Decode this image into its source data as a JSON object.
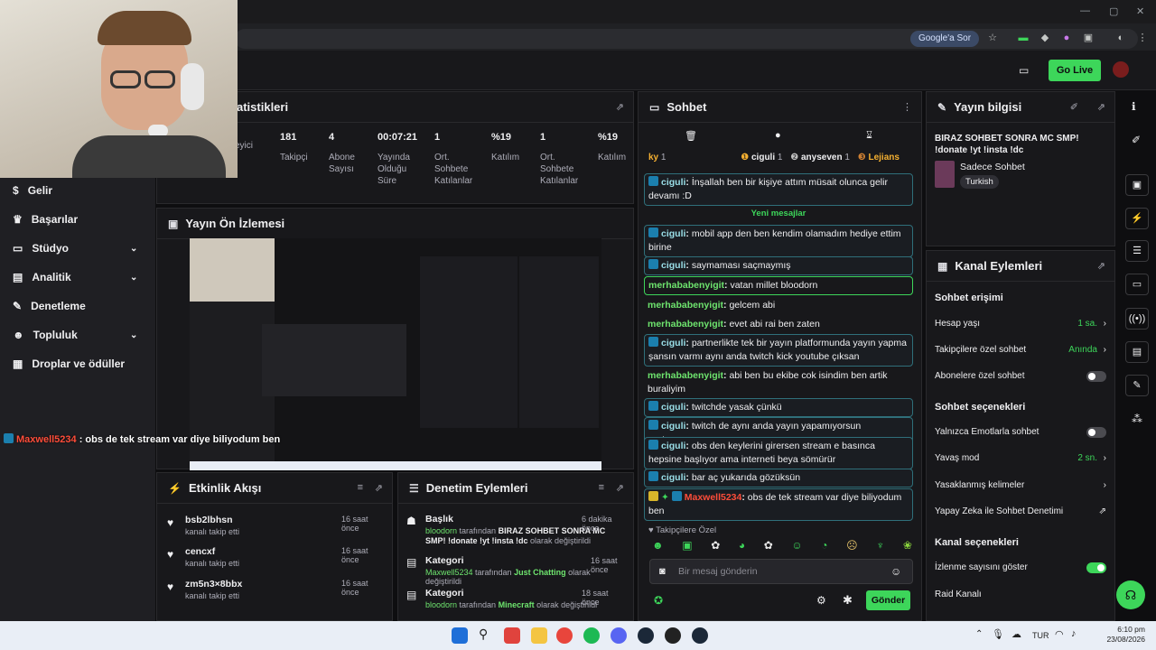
{
  "browser": {
    "google_sor": "Google'a Sor"
  },
  "topnav": {
    "go_live": "Go Live"
  },
  "stats": {
    "title": "atistikleri",
    "items": [
      {
        "value": "",
        "label": "eyici"
      },
      {
        "value": "181",
        "label": "Takipçi"
      },
      {
        "value": "4",
        "label": "Abone\nSayısı"
      },
      {
        "value": "00:07:21",
        "label": "Yayında\nOlduğu\nSüre"
      },
      {
        "value": "1",
        "label": "Ort.\nSohbete\nKatılanlar"
      },
      {
        "value": "%19",
        "label": "Katılım"
      },
      {
        "value": "1",
        "label": "Ort.\nSohbete\nKatılanlar"
      },
      {
        "value": "%19",
        "label": "Katılım"
      }
    ]
  },
  "sidebar": {
    "items": [
      {
        "label": "Gelir",
        "icon": "dollar-icon"
      },
      {
        "label": "Başarılar",
        "icon": "trophy-icon"
      },
      {
        "label": "Stüdyo",
        "icon": "studio-icon"
      },
      {
        "label": "Analitik",
        "icon": "analytics-icon"
      },
      {
        "label": "Denetleme",
        "icon": "wrench-icon"
      },
      {
        "label": "Topluluk",
        "icon": "people-icon"
      },
      {
        "label": "Droplar ve ödüller",
        "icon": "gift-icon"
      }
    ]
  },
  "preview": {
    "title": "Yayın Ön İzlemesi"
  },
  "overlay": {
    "user": "Maxwell5234",
    "text": " : obs de tek stream var diye biliyodum ben"
  },
  "chat": {
    "title": "Sohbet",
    "leaderboard": [
      {
        "name": "ky",
        "count": "1"
      },
      {
        "name": "ciguli",
        "count": "1"
      },
      {
        "name": "anyseven",
        "count": "1"
      },
      {
        "name": "Lejians",
        "count": ""
      }
    ],
    "new_messages": "Yeni mesajlar",
    "messages": [
      {
        "user": "ciguli",
        "text": " İnşallah ben bir kişiye attım müsait olunca gelir devamı :D"
      },
      {
        "user": "ciguli",
        "text": " mobil app den ben kendim olamadım hediye ettim birine"
      },
      {
        "user": "ciguli",
        "text": " saymaması saçmaymış"
      },
      {
        "user": "merhababenyigit",
        "text": " vatan millet bloodorn"
      },
      {
        "user": "merhababenyigit",
        "text": " gelcem abi"
      },
      {
        "user": "merhababenyigit",
        "text": " evet abi rai ben zaten"
      },
      {
        "user": "ciguli",
        "text": " partnerlikte tek bir yayın platformunda yayın yapma şansın varmı aynı anda twitch kick youtube çıksan"
      },
      {
        "user": "merhababenyigit",
        "text": " abi ben bu ekibe cok isindim ben artik buraliyim"
      },
      {
        "user": "ciguli",
        "text": " twitchde yasak çünkü"
      },
      {
        "user": "ciguli",
        "text": " twitch de aynı anda yayın yapamıyorsun partnersen"
      },
      {
        "user": "ciguli",
        "text": " obs den keylerini girersen stream e basınca hepsine başlıyor ama interneti beya sömürür"
      },
      {
        "user": "ciguli",
        "text": " bar aç yukarıda gözüksün"
      },
      {
        "user": "Maxwell5234",
        "text": " obs de tek stream var diye biliyodum ben"
      }
    ],
    "followers_only": "Takipçilere Özel",
    "input_placeholder": "Bir mesaj gönderin",
    "send_label": "Gönder"
  },
  "stream_info": {
    "title": "Yayın bilgisi",
    "stream_title": "BIRAZ SOHBET SONRA MC SMP! !donate !yt !insta !dc",
    "category": "Sadece Sohbet",
    "language": "Turkish"
  },
  "channel_actions": {
    "title": "Kanal Eylemleri",
    "chat_access_heading": "Sohbet erişimi",
    "account_age_label": "Hesap yaşı",
    "account_age_value": "1 sa.",
    "followers_chat_label": "Takipçilere özel sohbet",
    "followers_chat_value": "Anında",
    "subscribers_chat_label": "Abonelere özel sohbet",
    "chat_options_heading": "Sohbet seçenekleri",
    "emote_only_label": "Yalnızca Emotlarla sohbet",
    "slow_mode_label": "Yavaş mod",
    "slow_mode_value": "2 sn.",
    "banned_words_label": "Yasaklanmış kelimeler",
    "ai_moderation_label": "Yapay Zeka ile Sohbet Denetimi",
    "channel_options_heading": "Kanal seçenekleri",
    "show_viewcount_label": "İzlenme sayısını göster",
    "raid_label": "Raid Kanalı"
  },
  "activity_feed": {
    "title": "Etkinlik Akışı",
    "items": [
      {
        "name": "bsb2lbhsn",
        "sub": "kanalı takip etti",
        "time": "16 saat önce"
      },
      {
        "name": "cencxf",
        "sub": "kanalı takip etti",
        "time": "16 saat önce"
      },
      {
        "name": "zm5n3×8bbx",
        "sub": "kanalı takip etti",
        "time": "16 saat önce"
      }
    ]
  },
  "mod_actions": {
    "title": "Denetim Eylemleri",
    "items": [
      {
        "kind": "Başlık",
        "time": "6 dakika önce",
        "actor": "bloodorn",
        "mid": " tarafından ",
        "target": "BIRAZ SOHBET SONRA MC SMP! !donate !yt !insta !dc",
        "end": " olarak değiştirildi"
      },
      {
        "kind": "Kategori",
        "time": "16 saat önce",
        "actor": "Maxwell5234",
        "mid": " tarafından ",
        "target": "Just Chatting",
        "end": " olarak değiştirildi"
      },
      {
        "kind": "Kategori",
        "time": "18 saat önce",
        "actor": "bloodorn",
        "mid": " tarafından ",
        "target": "Minecraft",
        "end": " olarak değiştirildi"
      }
    ]
  },
  "taskbar": {
    "lang": "TUR",
    "time": "6:10 pm",
    "date": "23/08/2026"
  },
  "colors": {
    "accent": "#3dd65a",
    "panel": "#18181b",
    "background": "#0e0e10"
  }
}
